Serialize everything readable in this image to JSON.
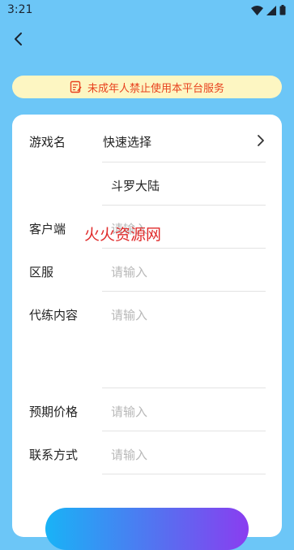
{
  "status_bar": {
    "time": "3:21"
  },
  "banner": {
    "text": "未成年人禁止使用本平台服务"
  },
  "form": {
    "game": {
      "label": "游戏名",
      "quick_select": "快速选择",
      "value": "斗罗大陆"
    },
    "client": {
      "label": "客户端",
      "placeholder": "请输入"
    },
    "server": {
      "label": "区服",
      "placeholder": "请输入"
    },
    "content": {
      "label": "代练内容",
      "placeholder": "请输入"
    },
    "price": {
      "label": "预期价格",
      "placeholder": "请输入"
    },
    "contact": {
      "label": "联系方式",
      "placeholder": "请输入"
    }
  },
  "watermark": "火火资源网",
  "colors": {
    "background": "#6cc6f7",
    "banner_bg": "#fdf6c2",
    "banner_text": "#e8421f",
    "placeholder": "#b8b8b8",
    "watermark": "#e02b2b"
  },
  "icons": [
    "wifi-icon",
    "signal-icon",
    "battery-icon",
    "back-arrow-icon",
    "notice-icon",
    "chevron-right-icon"
  ]
}
